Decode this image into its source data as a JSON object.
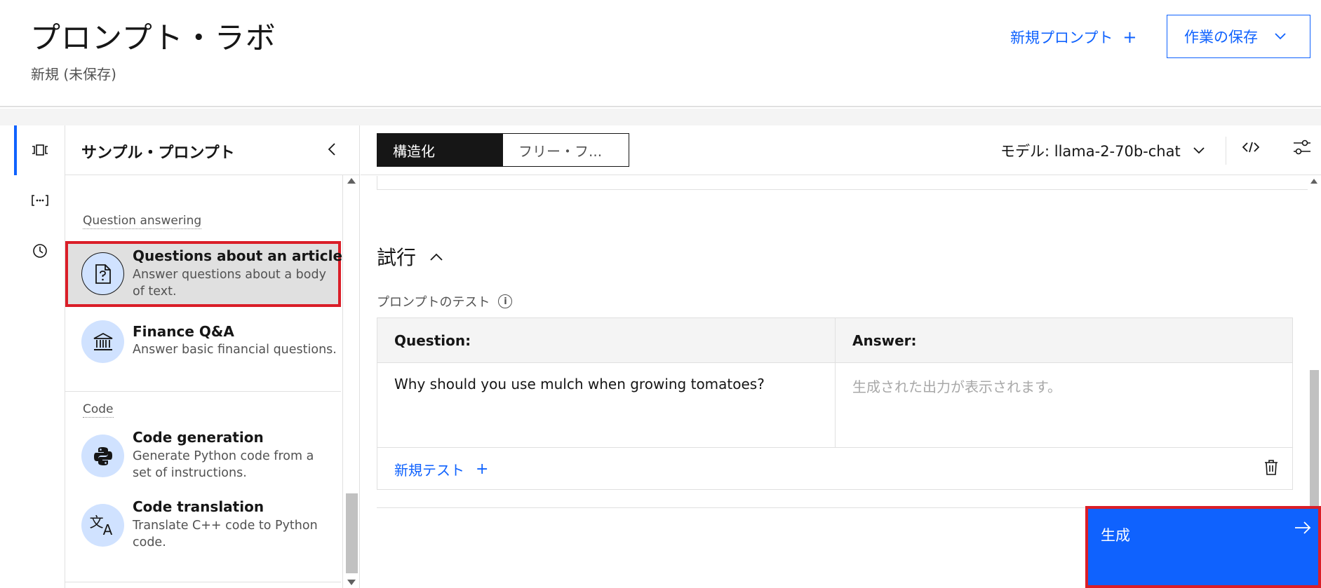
{
  "header": {
    "title": "プロンプト・ラボ",
    "subtitle": "新規 (未保存)",
    "new_prompt_label": "新規プロンプト",
    "save_label": "作業の保存"
  },
  "panel": {
    "title": "サンプル・プロンプト",
    "sections": [
      {
        "label": "Question answering",
        "items": [
          {
            "title": "Questions about an article",
            "desc": "Answer questions about a body of text.",
            "icon": "document-question-icon"
          },
          {
            "title": "Finance Q&A",
            "desc": "Answer basic financial questions.",
            "icon": "bank-icon"
          }
        ]
      },
      {
        "label": "Code",
        "items": [
          {
            "title": "Code generation",
            "desc": "Generate Python code from a set of instructions.",
            "icon": "python-icon"
          },
          {
            "title": "Code translation",
            "desc": "Translate C++ code to Python code.",
            "icon": "translate-icon"
          }
        ]
      }
    ]
  },
  "toolbar": {
    "mode_structured": "構造化",
    "mode_freeform": "フリー・フ...",
    "model_label": "モデル: llama-2-70b-chat"
  },
  "trial": {
    "heading": "試行",
    "test_label": "プロンプトのテスト",
    "columns": [
      "Question:",
      "Answer:"
    ],
    "question_value": "Why should you use mulch when growing tomatoes?",
    "answer_placeholder": "生成された出力が表示されます。",
    "new_test_label": "新規テスト"
  },
  "generate_label": "生成",
  "colors": {
    "accent": "#0f62fe",
    "highlight": "#da1e28",
    "icon_bg": "#d0e2ff"
  }
}
